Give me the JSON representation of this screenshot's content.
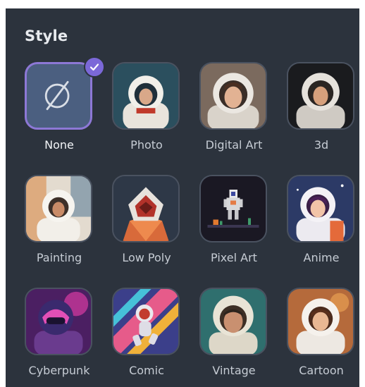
{
  "panel": {
    "title": "Style",
    "selected": "None",
    "accent_color": "#7b68d8",
    "styles": [
      {
        "label": "None",
        "icon": "no-style-icon"
      },
      {
        "label": "Photo",
        "icon": "astronaut-photo-thumbnail"
      },
      {
        "label": "Digital Art",
        "icon": "astronaut-digital-art-thumbnail"
      },
      {
        "label": "3d",
        "icon": "astronaut-3d-thumbnail"
      },
      {
        "label": "Painting",
        "icon": "astronaut-painting-thumbnail"
      },
      {
        "label": "Low Poly",
        "icon": "astronaut-low-poly-thumbnail"
      },
      {
        "label": "Pixel Art",
        "icon": "astronaut-pixel-art-thumbnail"
      },
      {
        "label": "Anime",
        "icon": "astronaut-anime-thumbnail"
      },
      {
        "label": "Cyberpunk",
        "icon": "astronaut-cyberpunk-thumbnail"
      },
      {
        "label": "Comic",
        "icon": "astronaut-comic-thumbnail"
      },
      {
        "label": "Vintage",
        "icon": "astronaut-vintage-thumbnail"
      },
      {
        "label": "Cartoon",
        "icon": "astronaut-cartoon-thumbnail"
      }
    ]
  }
}
